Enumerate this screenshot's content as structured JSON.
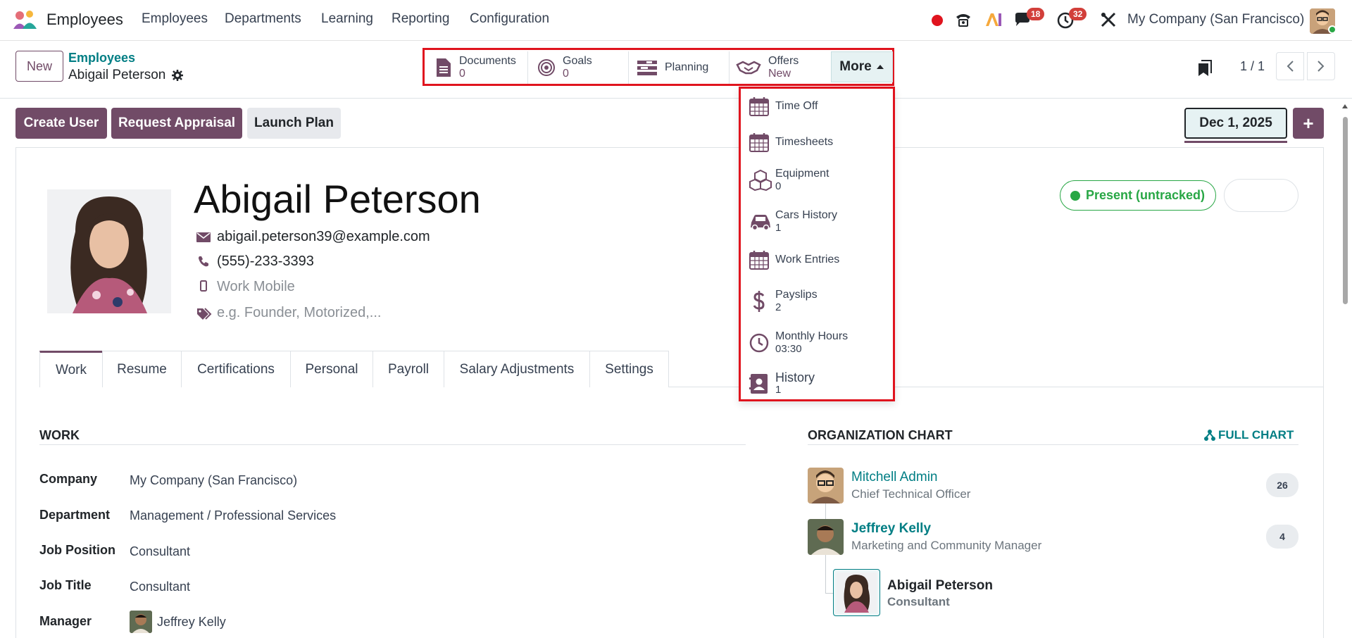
{
  "nav": {
    "app_title": "Employees",
    "menu": [
      "Employees",
      "Departments",
      "Learning",
      "Reporting",
      "Configuration"
    ],
    "chat_badge": "18",
    "activity_badge": "32",
    "company": "My Company (San Francisco)"
  },
  "breadcrumb": {
    "new_label": "New",
    "parent": "Employees",
    "current": "Abigail Peterson"
  },
  "smart_buttons": [
    {
      "label": "Documents",
      "value": "0"
    },
    {
      "label": "Goals",
      "value": "0"
    },
    {
      "label": "Planning",
      "value": ""
    },
    {
      "label": "Offers",
      "value": "New"
    }
  ],
  "more_label": "More",
  "pager": "1 / 1",
  "more_menu": [
    {
      "label": "Time Off",
      "value": ""
    },
    {
      "label": "Timesheets",
      "value": ""
    },
    {
      "label": "Equipment",
      "value": "0"
    },
    {
      "label": "Cars History",
      "value": "1"
    },
    {
      "label": "Work Entries",
      "value": ""
    },
    {
      "label": "Payslips",
      "value": "2"
    },
    {
      "label": "Monthly Hours",
      "value": "03:30"
    },
    {
      "label": "History",
      "value": "1"
    }
  ],
  "actions": {
    "create_user": "Create User",
    "request_appraisal": "Request Appraisal",
    "launch_plan": "Launch Plan",
    "date": "Dec 1, 2025",
    "plus": "+"
  },
  "employee": {
    "name": "Abigail Peterson",
    "email": "abigail.peterson39@example.com",
    "phone": "(555)-233-3393",
    "work_mobile_placeholder": "Work Mobile",
    "tags_placeholder": "e.g. Founder, Motorized,...",
    "presence": "Present (untracked)"
  },
  "tabs": [
    "Work",
    "Resume",
    "Certifications",
    "Personal",
    "Payroll",
    "Salary Adjustments",
    "Settings"
  ],
  "work": {
    "section_title": "WORK",
    "fields": [
      {
        "label": "Company",
        "value": "My Company (San Francisco)"
      },
      {
        "label": "Department",
        "value": "Management / Professional Services"
      },
      {
        "label": "Job Position",
        "value": "Consultant"
      },
      {
        "label": "Job Title",
        "value": "Consultant"
      },
      {
        "label": "Manager",
        "value": "Jeffrey Kelly"
      }
    ]
  },
  "org_chart": {
    "title": "ORGANIZATION CHART",
    "full_chart": "FULL CHART",
    "nodes": [
      {
        "name": "Mitchell Admin",
        "role": "Chief Technical Officer",
        "count": "26"
      },
      {
        "name": "Jeffrey Kelly",
        "role": "Marketing and Community Manager",
        "count": "4"
      },
      {
        "name": "Abigail Peterson",
        "role": "Consultant",
        "count": ""
      }
    ]
  },
  "colors": {
    "brand": "#714b67",
    "teal": "#017e84",
    "highlight": "#e0141e",
    "present": "#28a745"
  }
}
